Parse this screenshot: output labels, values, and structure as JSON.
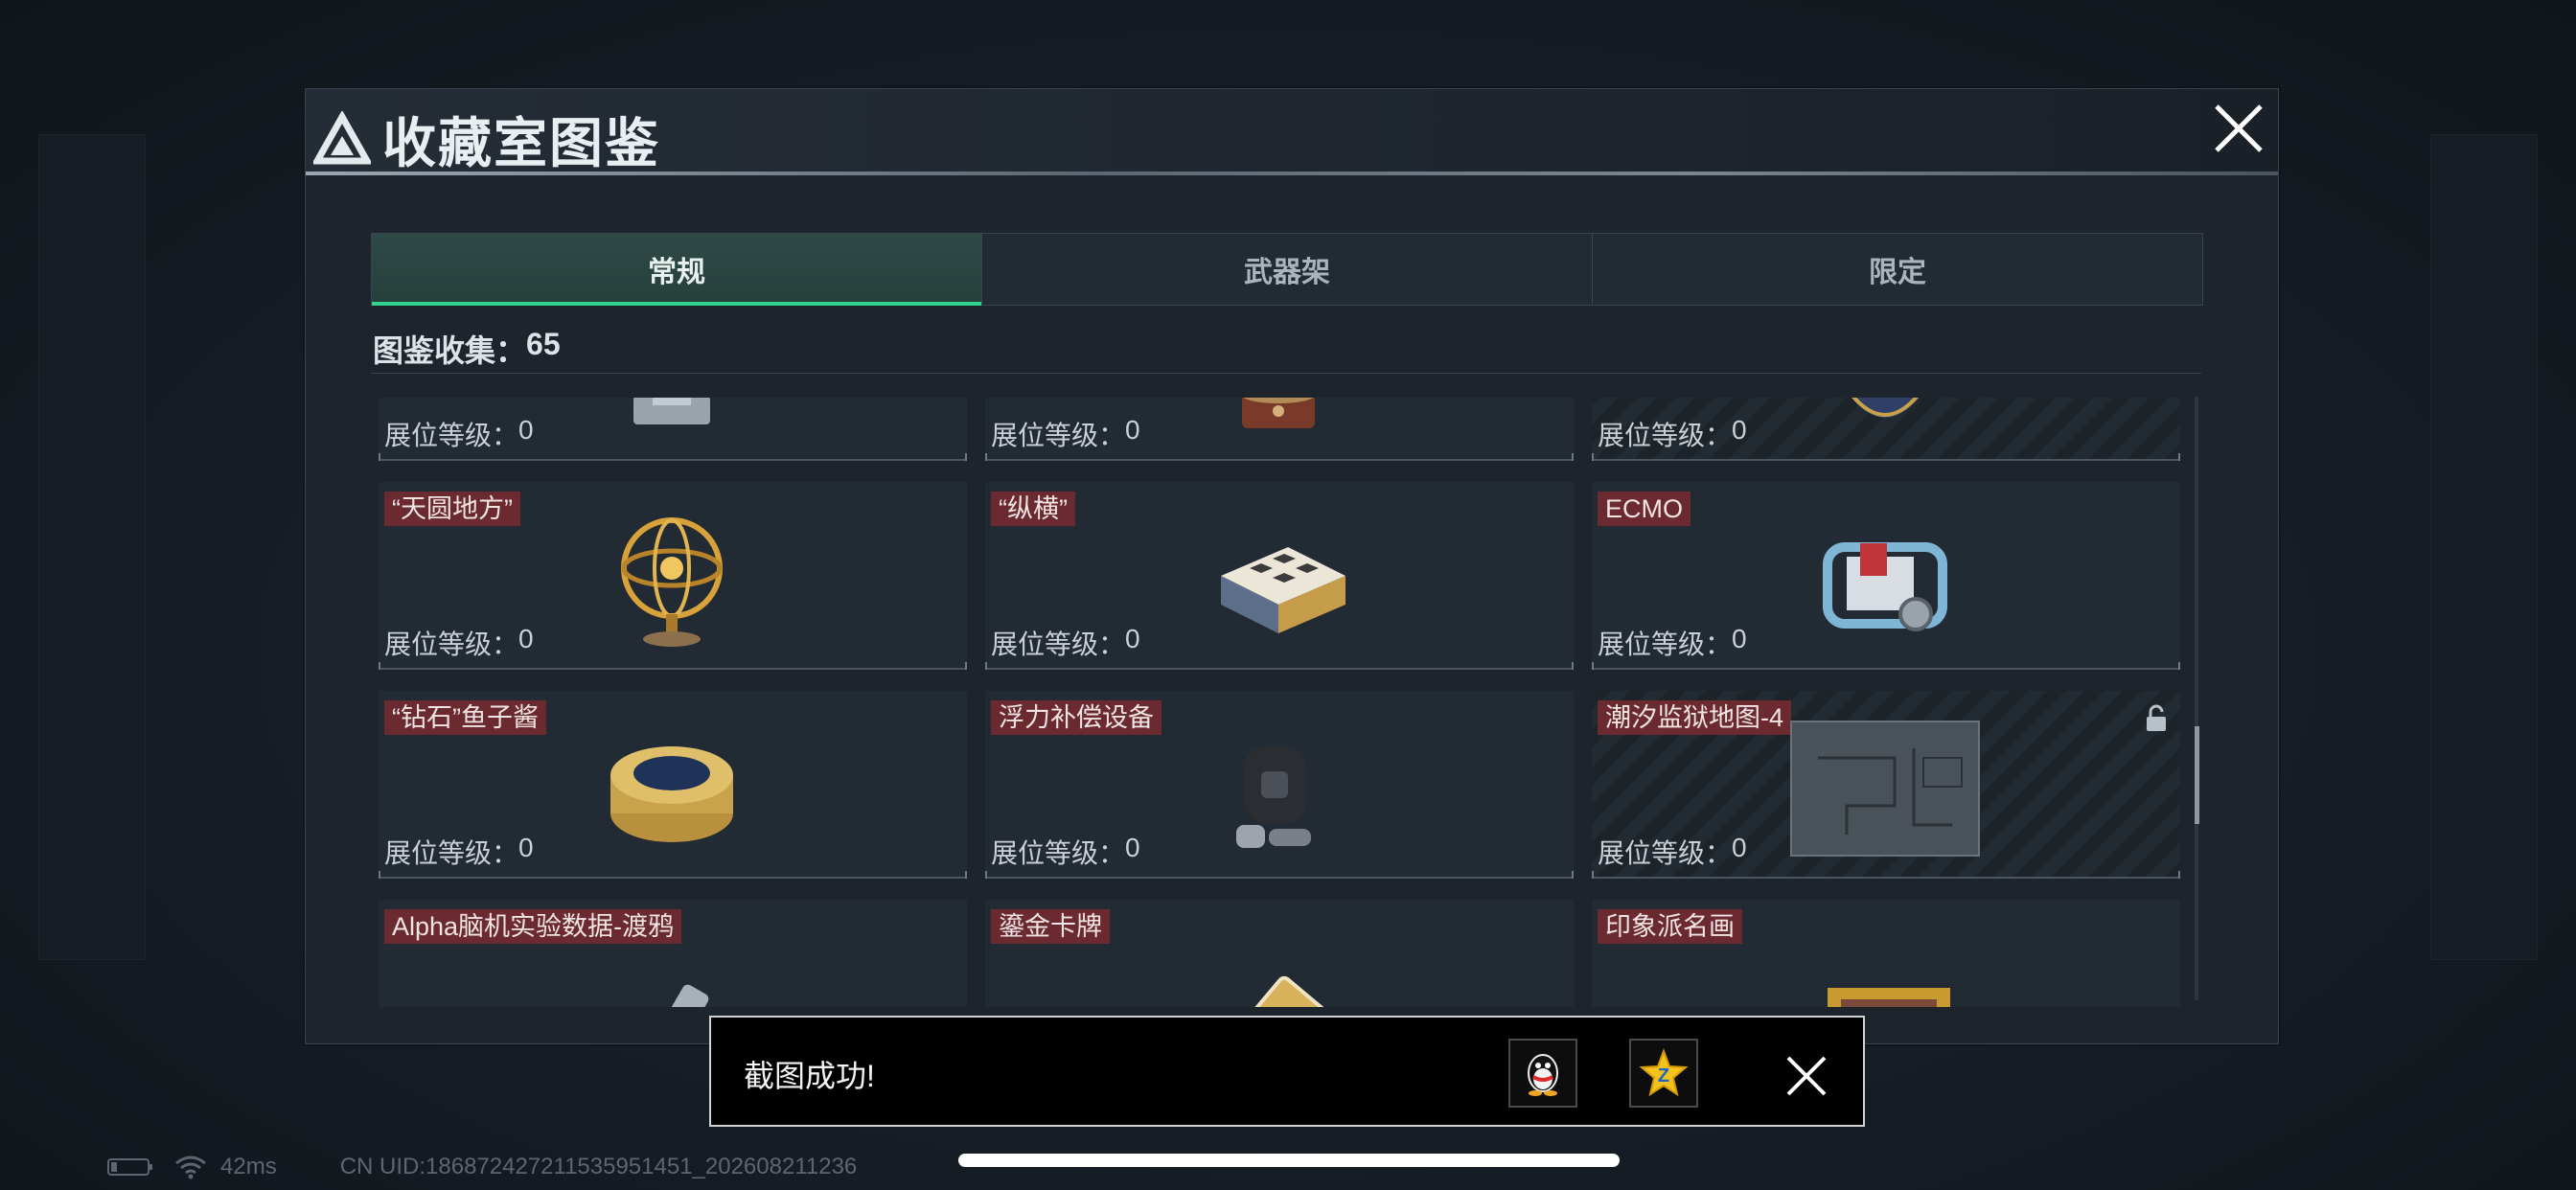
{
  "window": {
    "title": "收藏室图鉴"
  },
  "tabs": [
    {
      "label": "常规",
      "active": true
    },
    {
      "label": "武器架",
      "active": false
    },
    {
      "label": "限定",
      "active": false
    }
  ],
  "collection": {
    "label": "图鉴收集：",
    "count": "65"
  },
  "level_label": "展位等级：",
  "items": [
    {
      "name": "",
      "level": "0",
      "icon": "turret-icon",
      "locked": false
    },
    {
      "name": "",
      "level": "0",
      "icon": "gramophone-icon",
      "locked": false
    },
    {
      "name": "",
      "level": "0",
      "icon": "vase-icon",
      "locked": true
    },
    {
      "name": "“天圆地方”",
      "level": "0",
      "icon": "armillary-sphere-icon",
      "locked": false
    },
    {
      "name": "“纵横”",
      "level": "0",
      "icon": "chess-box-icon",
      "locked": false
    },
    {
      "name": "ECMO",
      "level": "0",
      "icon": "ecmo-machine-icon",
      "locked": false
    },
    {
      "name": "“钻石”鱼子酱",
      "level": "0",
      "icon": "caviar-tin-icon",
      "locked": false
    },
    {
      "name": "浮力补偿设备",
      "level": "0",
      "icon": "buoyancy-vest-icon",
      "locked": false
    },
    {
      "name": "潮汐监狱地图-4",
      "level": "0",
      "icon": "map-icon",
      "locked": true
    },
    {
      "name": "Alpha脑机实验数据-渡鸦",
      "level": "",
      "icon": "data-drive-icon",
      "locked": false
    },
    {
      "name": "鎏金卡牌",
      "level": "",
      "icon": "gold-card-icon",
      "locked": false
    },
    {
      "name": "印象派名画",
      "level": "",
      "icon": "painting-icon",
      "locked": false
    }
  ],
  "toast": {
    "message": "截图成功!"
  },
  "status": {
    "ping": "42ms",
    "uid": "CN UID:18687242721153595145​1_202608211236"
  },
  "colors": {
    "accent": "#2fd28f",
    "name_tag": "#6a2a2f",
    "panel": "#1d242c"
  }
}
